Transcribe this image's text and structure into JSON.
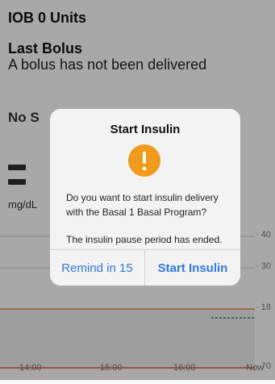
{
  "header": {
    "iob": "IOB 0 Units",
    "last_bolus_title": "Last Bolus",
    "last_bolus_text": "A bolus has not been delivered"
  },
  "glucose": {
    "status_prefix": "No S",
    "units": "mg/dL"
  },
  "chart_data": {
    "type": "line",
    "x_ticks": [
      "14:00",
      "15:00",
      "16:00",
      "Now"
    ],
    "y_ticks": [
      "40",
      "30",
      "18",
      "70"
    ],
    "colors": {
      "upper_line": "#e8892c",
      "lower_line": "#e0513c",
      "band": "#ececee",
      "trace": "#2e8b6e"
    }
  },
  "dialog": {
    "title": "Start Insulin",
    "icon": "warning-icon",
    "message": "Do you want to start insulin delivery with the Basal 1 Basal Program?",
    "message2": "The insulin pause period has ended.",
    "remind_label": "Remind in 15",
    "start_label": "Start Insulin"
  },
  "colors": {
    "accent": "#2e7bf5",
    "warning": "#f09b1b"
  }
}
